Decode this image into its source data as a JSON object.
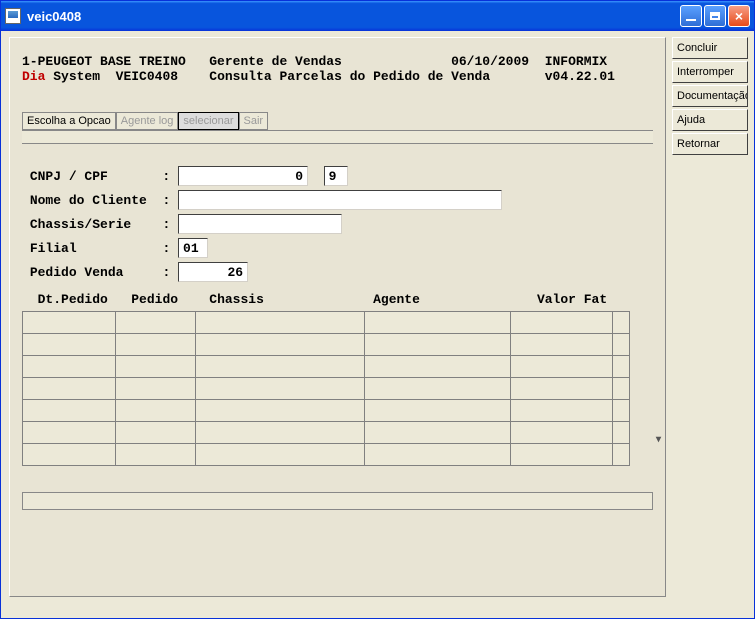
{
  "window": {
    "title": "veic0408"
  },
  "header": {
    "company": "1-PEUGEOT BASE TREINO",
    "role": "Gerente de Vendas",
    "date": "06/10/2009",
    "db": "INFORMIX",
    "dia": "Dia",
    "system": "System",
    "program": "VEIC0408",
    "subtitle": "Consulta Parcelas do Pedido de Venda",
    "version": "v04.22.01"
  },
  "menu": {
    "items": [
      {
        "label": "Escolha a Opcao",
        "enabled": true
      },
      {
        "label": "Agente log",
        "enabled": false
      },
      {
        "label": "selecionar",
        "enabled": false,
        "selected": true
      },
      {
        "label": "Sair",
        "enabled": false
      }
    ]
  },
  "form": {
    "labels": {
      "cpf": "CNPJ / CPF",
      "nome": "Nome do Cliente",
      "chassis": "Chassis/Serie",
      "filial": "Filial",
      "pedido": "Pedido Venda"
    },
    "values": {
      "cpf": "0",
      "cpf_dv": "9",
      "nome": "",
      "chassis": "",
      "filial": "01",
      "pedido": "26"
    }
  },
  "table": {
    "columns": [
      "Dt.Pedido",
      "Pedido",
      "Chassis",
      "Agente",
      "Valor Fat"
    ],
    "rows": [
      [],
      [],
      [],
      [],
      [],
      [],
      []
    ]
  },
  "side_buttons": [
    "Concluir",
    "Interromper",
    "Documentação",
    "Ajuda",
    "Retornar"
  ]
}
